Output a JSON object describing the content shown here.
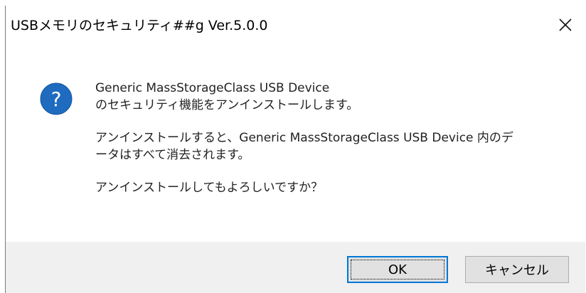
{
  "window": {
    "title": "USBメモリのセキュリティ##g Ver.5.0.0",
    "close_glyph": "✕"
  },
  "message": {
    "line1": "Generic MassStorageClass USB Device",
    "line2": "のセキュリティ機能をアンインストールします。",
    "line3": "アンインストールすると、Generic MassStorageClass USB Device 内のデ",
    "line4": "ータはすべて消去されます。",
    "line5": "アンインストールしてもよろしいですか？"
  },
  "icon": {
    "name": "question-icon",
    "glyph": "?",
    "color": "#1e6bbf"
  },
  "buttons": {
    "ok_label": "OK",
    "cancel_label": "キャンセル"
  }
}
